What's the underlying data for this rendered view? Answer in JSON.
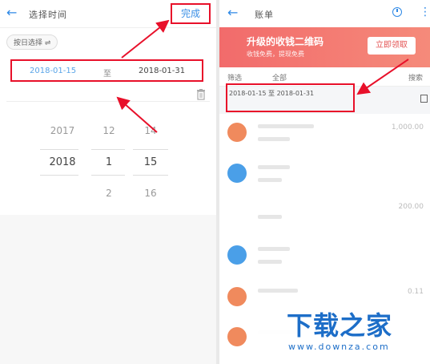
{
  "left_screen": {
    "title": "选择时间",
    "done_label": "完成",
    "chip_label": "按日选择 ⇌",
    "range": {
      "start": "2018-01-15",
      "separator": "至",
      "end": "2018-01-31"
    },
    "picker": {
      "years": [
        "2017",
        "2018"
      ],
      "months": [
        "12",
        "1",
        "2"
      ],
      "days": [
        "14",
        "15",
        "16"
      ]
    }
  },
  "right_screen": {
    "title": "账单",
    "banner": {
      "title": "升级的收钱二维码",
      "subtitle": "收钱免费，提现免费",
      "button": "立即领取"
    },
    "filters": {
      "filter": "筛选",
      "all": "全部",
      "search": "搜索"
    },
    "range_text": "2018-01-15 至 2018-01-31",
    "amounts": [
      "1,000.00",
      "200.00",
      "0.11"
    ]
  },
  "watermark": {
    "brand": "下载之家",
    "site": "www.downza.com"
  },
  "colors": {
    "accent": "#2f89e6",
    "highlight": "#e8102a",
    "banner": "#f26b6b",
    "watermark": "#1d6ec8"
  }
}
